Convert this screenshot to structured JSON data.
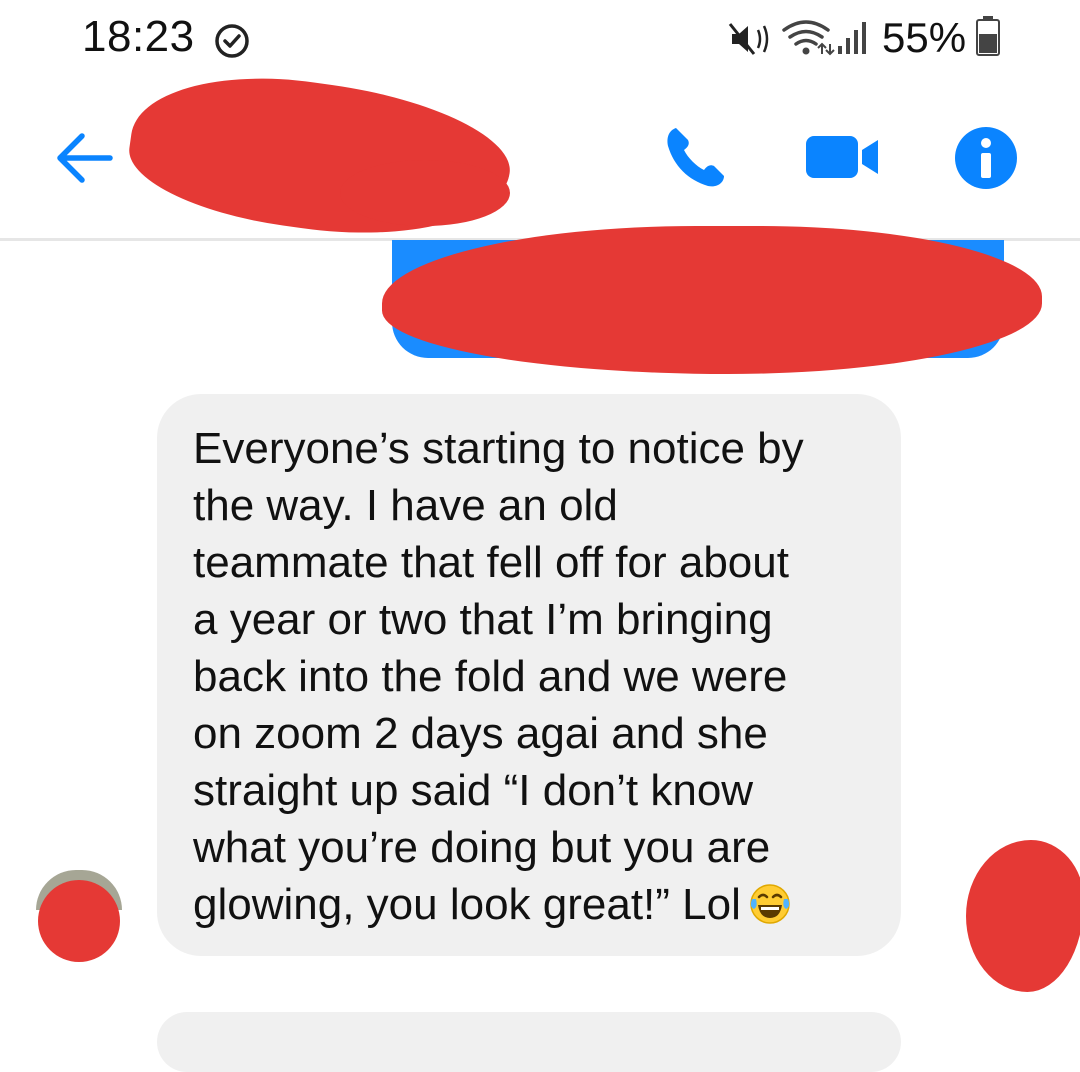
{
  "status_bar": {
    "time": "18:23",
    "battery_percent": "55%",
    "icons": [
      "alarm-icon",
      "mute-icon",
      "wifi-icon",
      "signal-icon",
      "battery-icon"
    ]
  },
  "header": {
    "icons": [
      "back-icon",
      "phone-icon",
      "video-icon",
      "info-icon"
    ],
    "accent_color": "#0a84ff"
  },
  "messages": [
    {
      "direction": "received",
      "text": "Everyone’s starting to notice by\nthe way. I have an old\nteammate that fell off for about\na year or two that I’m bringing\nback into the fold and we were\non zoom 2 days agai and she\nstraight up said “I don’t know\nwhat you’re doing but you are\nglowing, you look great!” Lol",
      "trailing_emoji": "face-with-tears-of-joy-icon"
    }
  ],
  "colors": {
    "received_bubble": "#f0f0f0",
    "sent_bubble": "#1a8cff",
    "redaction": "#e53935"
  }
}
